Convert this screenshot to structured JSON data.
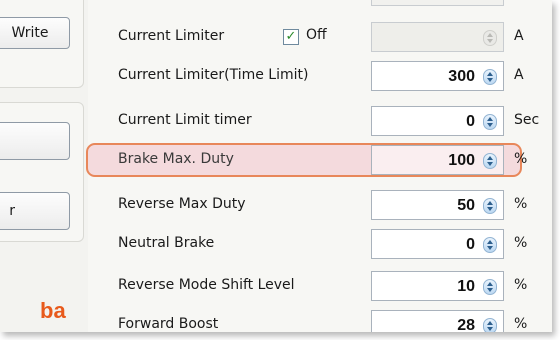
{
  "left_panel": {
    "write_button": "Write",
    "button_2": "",
    "button_3": "r",
    "logo": "ba"
  },
  "rows": [
    {
      "label": "Current Limiter",
      "checkbox_label": "Off",
      "checked": true,
      "value": "",
      "unit": "A"
    },
    {
      "label": "Current Limiter(Time Limit)",
      "value": "300",
      "unit": "A"
    },
    {
      "label": "Current Limit timer",
      "value": "0",
      "unit": "Sec"
    },
    {
      "label": "Brake Max. Duty",
      "value": "100",
      "unit": "%"
    },
    {
      "label": "Reverse Max Duty",
      "value": "50",
      "unit": "%"
    },
    {
      "label": "Neutral Brake",
      "value": "0",
      "unit": "%"
    },
    {
      "label": "Reverse Mode Shift Level",
      "value": "10",
      "unit": "%"
    },
    {
      "label": "Forward Boost",
      "value": "28",
      "unit": "%"
    }
  ],
  "icons": {
    "checkbox": "check-icon",
    "spinner": "spin-arrows-icon"
  },
  "colors": {
    "highlight_border": "#e8875a",
    "highlight_fill": "#f0a0af",
    "logo": "#e85a1c"
  }
}
